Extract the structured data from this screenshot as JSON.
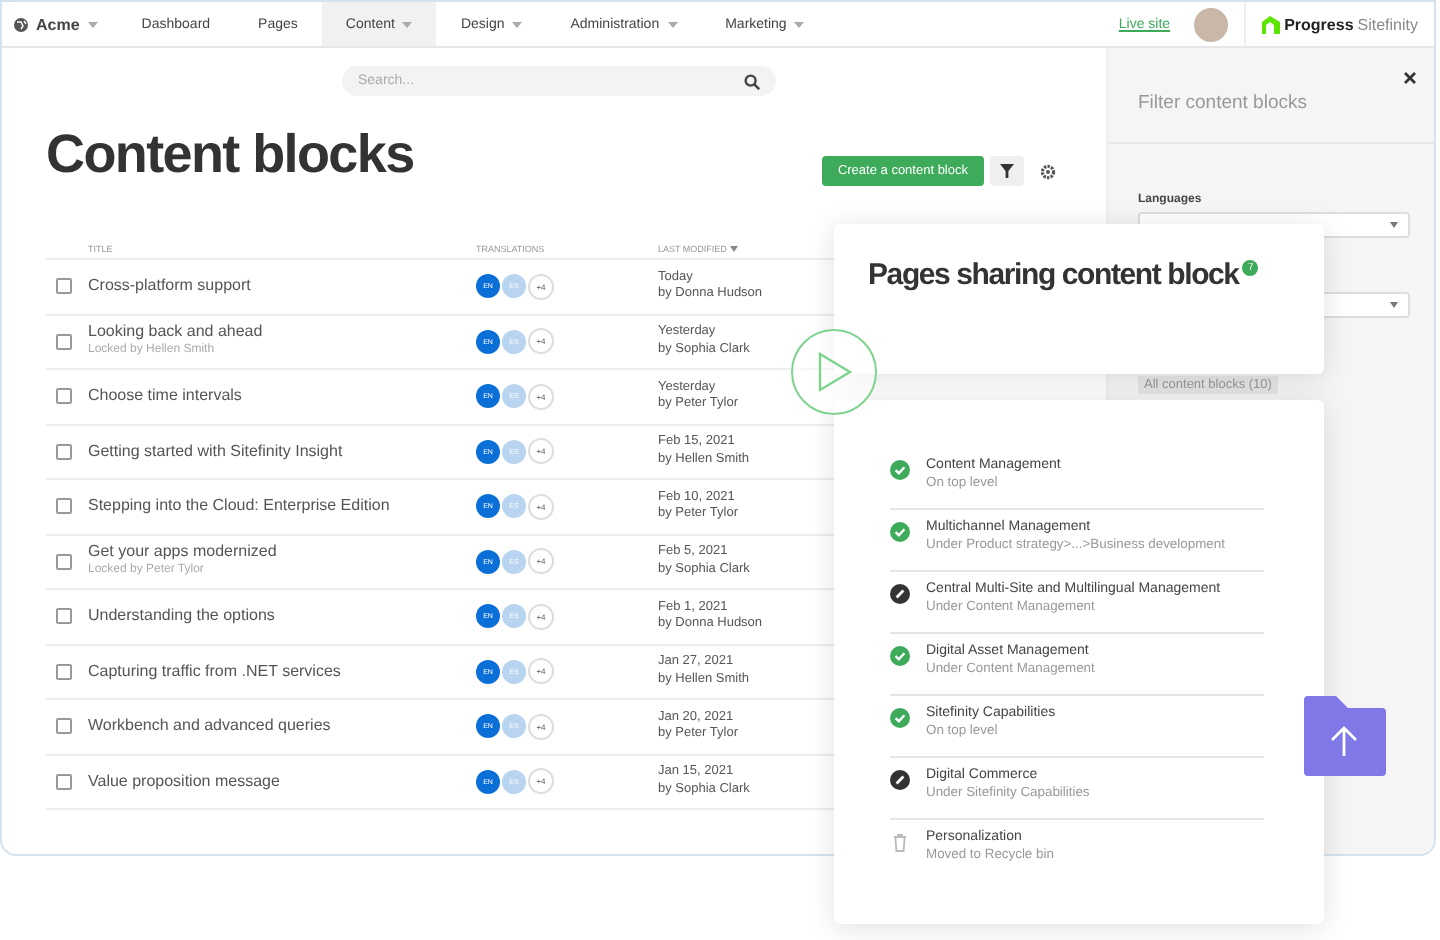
{
  "nav": {
    "brand": "Acme",
    "items": [
      {
        "label": "Dashboard",
        "selected": false,
        "dropdown": false
      },
      {
        "label": "Pages",
        "selected": false,
        "dropdown": false
      },
      {
        "label": "Content",
        "selected": true,
        "dropdown": true
      },
      {
        "label": "Design",
        "selected": false,
        "dropdown": true
      },
      {
        "label": "Administration",
        "selected": false,
        "dropdown": true
      },
      {
        "label": "Marketing",
        "selected": false,
        "dropdown": true
      }
    ],
    "live_site": "Live site",
    "logo_main": "Progress",
    "logo_product": "Sitefinity"
  },
  "search": {
    "placeholder": "Search..."
  },
  "title": "Content blocks",
  "create_button": "Create a content block",
  "table": {
    "columns": [
      "TITLE",
      "TRANSLATIONS",
      "LAST MODIFIED"
    ],
    "rows": [
      {
        "checked": false,
        "title": "Cross-platform support",
        "translations": [
          {
            "label": "EN",
            "published": true
          },
          {
            "label": "ES",
            "published": false
          }
        ],
        "more": "+4",
        "date": "Today",
        "author": "by Donna Hudson"
      },
      {
        "checked": false,
        "title": "Looking back and ahead",
        "locked_by": "Locked by Hellen Smith",
        "translations": [
          {
            "label": "EN",
            "published": true
          },
          {
            "label": "ES",
            "published": false
          }
        ],
        "more": "+4",
        "date": "Yesterday",
        "author": "by Sophia Clark"
      },
      {
        "checked": false,
        "title": "Choose time intervals",
        "translations": [
          {
            "label": "EN",
            "published": true
          },
          {
            "label": "ES",
            "published": false
          }
        ],
        "more": "+4",
        "date": "Yesterday",
        "author": "by Peter Tylor"
      },
      {
        "checked": false,
        "title": "Getting started with Sitefinity Insight",
        "translations": [
          {
            "label": "EN",
            "published": true
          },
          {
            "label": "ES",
            "published": false
          }
        ],
        "more": "+4",
        "date": "Feb 15, 2021",
        "author": "by Hellen Smith"
      },
      {
        "checked": false,
        "title": "Stepping into the Cloud: Enterprise Edition",
        "translations": [
          {
            "label": "EN",
            "published": true
          },
          {
            "label": "ES",
            "published": false
          }
        ],
        "more": "+4",
        "date": "Feb 10, 2021",
        "author": "by Peter Tylor"
      },
      {
        "checked": false,
        "title": "Get your apps modernized",
        "locked_by": "Locked by Peter Tylor",
        "translations": [
          {
            "label": "EN",
            "published": true
          },
          {
            "label": "ES",
            "published": false
          }
        ],
        "more": "+4",
        "date": "Feb 5, 2021",
        "author": "by Sophia Clark"
      },
      {
        "checked": false,
        "title": "Understanding the options",
        "translations": [
          {
            "label": "EN",
            "published": true
          },
          {
            "label": "ES",
            "published": false
          }
        ],
        "more": "+4",
        "date": "Feb 1, 2021",
        "author": "by Donna Hudson"
      },
      {
        "checked": false,
        "title": "Capturing traffic from .NET services",
        "translations": [
          {
            "label": "EN",
            "published": true
          },
          {
            "label": "ES",
            "published": false
          }
        ],
        "more": "+4",
        "date": "Jan 27, 2021",
        "author": "by Hellen Smith"
      },
      {
        "checked": false,
        "title": "Workbench and advanced queries",
        "translations": [
          {
            "label": "EN",
            "published": true
          },
          {
            "label": "ES",
            "published": false
          }
        ],
        "more": "+4",
        "date": "Jan 20, 2021",
        "author": "by Peter Tylor"
      },
      {
        "checked": false,
        "title": "Value proposition message",
        "translations": [
          {
            "label": "EN",
            "published": true
          },
          {
            "label": "ES",
            "published": false
          }
        ],
        "more": "+4",
        "date": "Jan 15, 2021",
        "author": "by Sophia Clark"
      }
    ]
  },
  "filter": {
    "title": "Filter content blocks",
    "languages_label": "Languages",
    "views": [
      {
        "label": "All content blocks (10)",
        "selected": true
      }
    ]
  },
  "sharing": {
    "title": "Pages sharing content block",
    "count": "7",
    "pages": [
      {
        "name": "Content Management",
        "location": "On top level",
        "kind": "published"
      },
      {
        "name": "Multichannel Management",
        "location": "Under Product strategy>...>Business development",
        "kind": "published"
      },
      {
        "name": "Central Multi-Site and Multilingual Management",
        "location": "Under Content Management",
        "kind": "draft"
      },
      {
        "name": "Digital Asset Management",
        "location": "Under Content Management",
        "kind": "published"
      },
      {
        "name": "Sitefinity Capabilities",
        "location": "On top level",
        "kind": "published"
      },
      {
        "name": "Digital Commerce",
        "location": "Under Sitefinity Capabilities",
        "kind": "draft"
      },
      {
        "name": "Personalization",
        "location": "Moved to Recycle bin",
        "kind": "deleted"
      }
    ]
  }
}
